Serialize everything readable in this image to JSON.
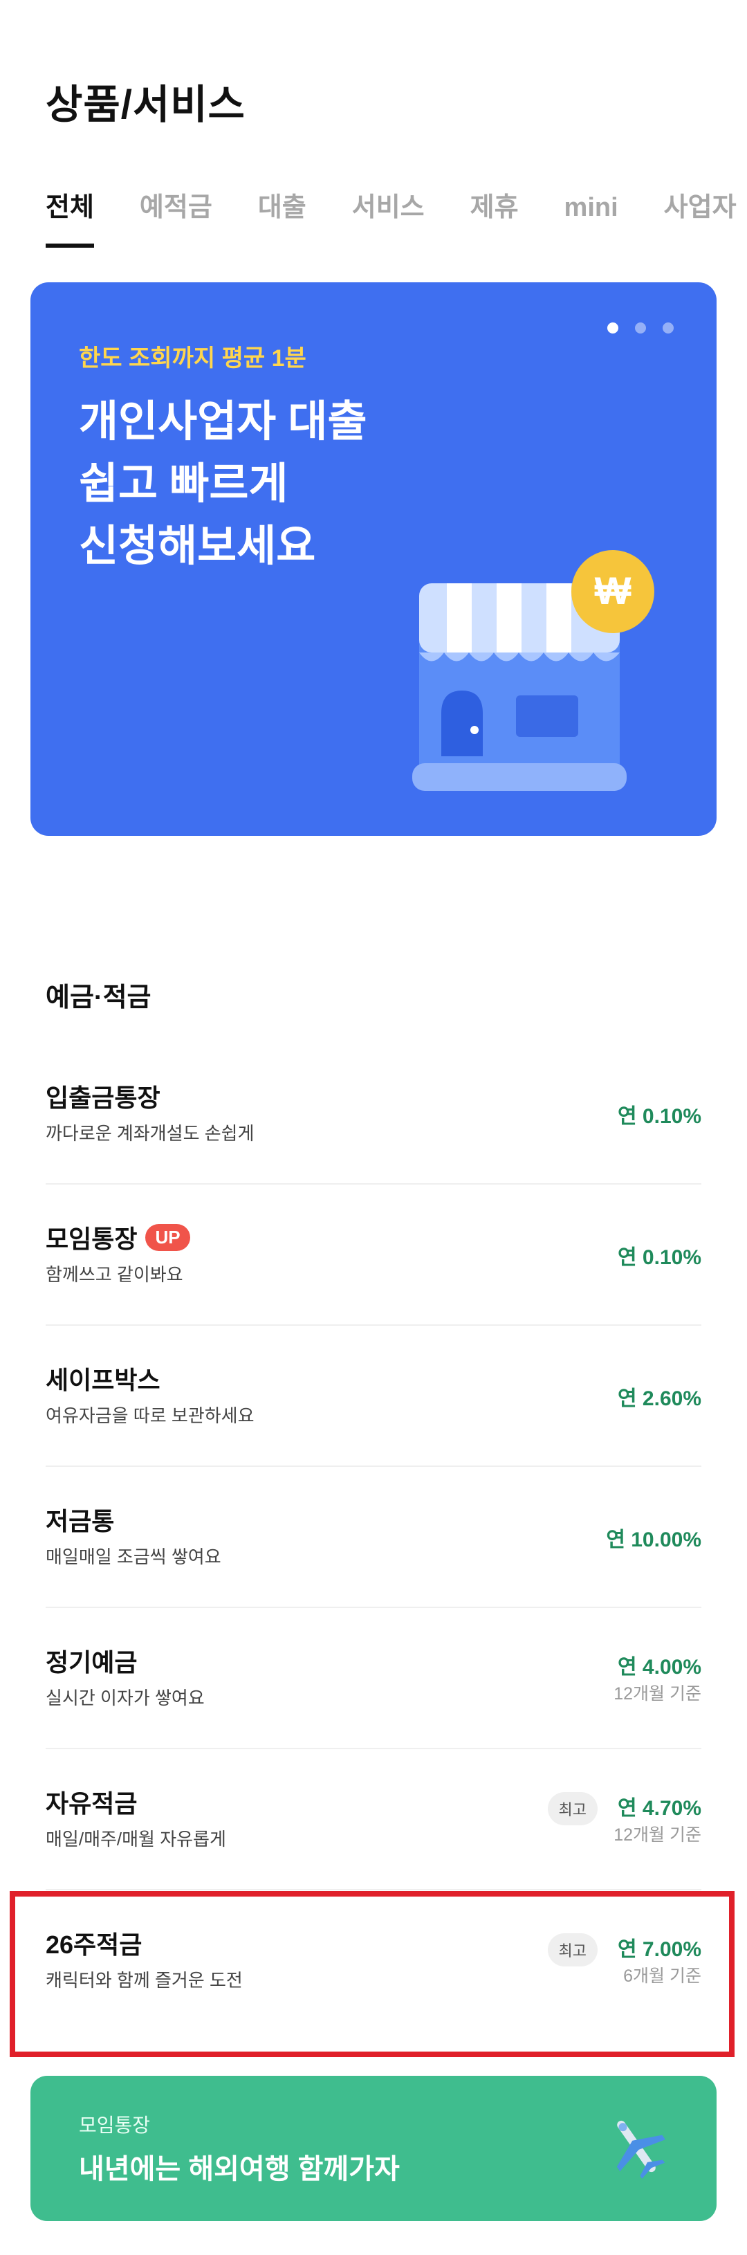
{
  "page": {
    "title": "상품/서비스"
  },
  "tabs": [
    {
      "label": "전체",
      "active": true
    },
    {
      "label": "예적금",
      "active": false
    },
    {
      "label": "대출",
      "active": false
    },
    {
      "label": "서비스",
      "active": false
    },
    {
      "label": "제휴",
      "active": false
    },
    {
      "label": "mini",
      "active": false
    },
    {
      "label": "사업자",
      "active": false
    }
  ],
  "banner": {
    "eyebrow": "한도 조회까지 평균 1분",
    "lines": [
      "개인사업자 대출",
      "쉽고 빠르게",
      "신청해보세요"
    ],
    "carousel_index": 1,
    "carousel_total": 3,
    "icon": "store-with-won-coin",
    "colors": {
      "background": "#3f6ff0",
      "eyebrow": "#ffd64d"
    }
  },
  "section": {
    "title": "예금·적금",
    "items": [
      {
        "name": "입출금통장",
        "desc": "까다로운 계좌개설도 손쉽게",
        "rate": "연 0.10%"
      },
      {
        "name": "모임통장",
        "badge": "UP",
        "desc": "함께쓰고 같이봐요",
        "rate": "연 0.10%"
      },
      {
        "name": "세이프박스",
        "desc": "여유자금을 따로 보관하세요",
        "rate": "연 2.60%"
      },
      {
        "name": "저금통",
        "desc": "매일매일 조금씩 쌓여요",
        "rate": "연 10.00%"
      },
      {
        "name": "정기예금",
        "desc": "실시간 이자가 쌓여요",
        "rate": "연 4.00%",
        "sub": "12개월 기준"
      },
      {
        "name": "자유적금",
        "desc": "매일/매주/매월 자유롭게",
        "rate": "연 4.70%",
        "sub": "12개월 기준",
        "tag": "최고"
      },
      {
        "name": "26주적금",
        "desc": "캐릭터와 함께 즐거운 도전",
        "rate": "연 7.00%",
        "sub": "6개월 기준",
        "tag": "최고"
      }
    ]
  },
  "promo": {
    "eyebrow": "모임통장",
    "title": "내년에는 해외여행 함께가자",
    "icon": "airplane-icon",
    "color": "#3fbd8e"
  }
}
